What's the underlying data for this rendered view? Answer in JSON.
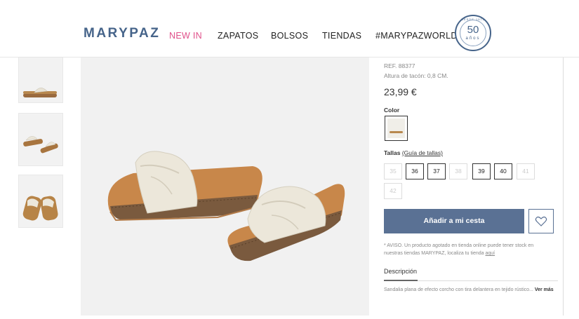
{
  "header": {
    "logo": "MARYPAZ",
    "nav": [
      "NEW IN",
      "ZAPATOS",
      "BOLSOS",
      "TIENDAS",
      "#MARYPAZWORLD"
    ],
    "badge": {
      "number": "50",
      "sub": "años",
      "arc": "DESDE 1972"
    }
  },
  "product": {
    "ref": "REF. 88377",
    "heel": "Altura de tacón: 0,8 CM.",
    "price": "23,99 €",
    "color_label": "Color",
    "sizes_label": "Tallas",
    "size_guide": "(Guía de tallas)",
    "sizes": [
      {
        "label": "35",
        "available": false
      },
      {
        "label": "36",
        "available": true
      },
      {
        "label": "37",
        "available": true
      },
      {
        "label": "38",
        "available": false
      },
      {
        "label": "39",
        "available": true
      },
      {
        "label": "40",
        "available": true
      },
      {
        "label": "41",
        "available": false
      },
      {
        "label": "42",
        "available": false
      }
    ],
    "add_to_cart": "Añadir a mi cesta",
    "notice": "* AVISO. Un producto agotado en tienda online puede tener stock en nuestras tiendas MARYPAZ, localiza tu tienda",
    "notice_link": "aquí",
    "description_tab": "Descripción",
    "description": "Sandalia plana de efecto corcho con tira delantera en tejido rústico...",
    "see_more": "Ver más"
  },
  "icons": {
    "favorite": "heart-icon"
  },
  "colors": {
    "brand": "#46648a",
    "accent_pink": "#e0508a",
    "button": "#5a7194"
  }
}
